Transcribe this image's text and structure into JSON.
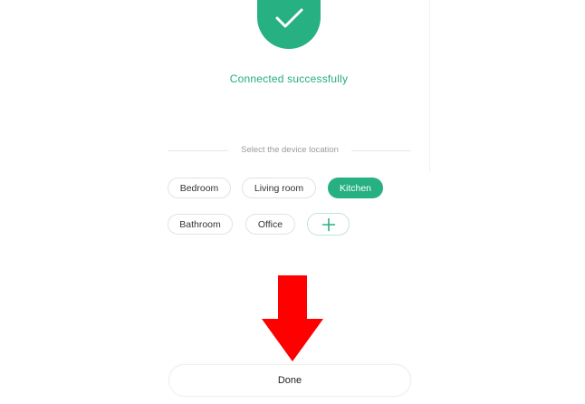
{
  "status": {
    "message": "Connected successfully",
    "icon": "checkmark-icon",
    "color": "#27b081"
  },
  "location": {
    "prompt": "Select the device location",
    "options": [
      {
        "label": "Bedroom",
        "selected": false
      },
      {
        "label": "Living room",
        "selected": false
      },
      {
        "label": "Kitchen",
        "selected": true
      },
      {
        "label": "Bathroom",
        "selected": false
      },
      {
        "label": "Office",
        "selected": false
      }
    ],
    "add_icon": "plus-icon"
  },
  "overlay": {
    "icon": "down-arrow-icon",
    "color": "#ff0000"
  },
  "actions": {
    "done_label": "Done"
  }
}
